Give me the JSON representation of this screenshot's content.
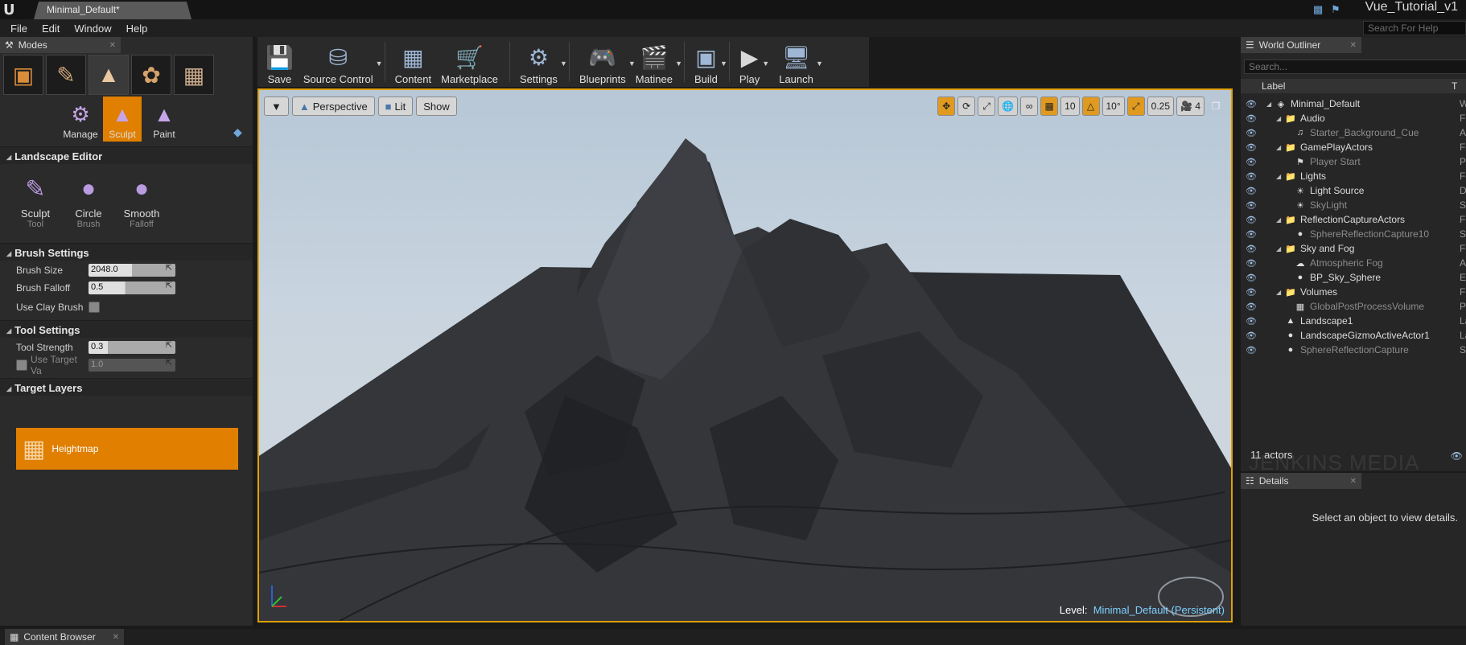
{
  "titlebar": {
    "doc_tab": "Minimal_Default*",
    "project": "Vue_Tutorial_v1"
  },
  "menu": {
    "items": [
      "File",
      "Edit",
      "Window",
      "Help"
    ],
    "help_search_placeholder": "Search For Help"
  },
  "modes": {
    "tab": "Modes",
    "landscape_tools": [
      {
        "label": "Manage",
        "active": false
      },
      {
        "label": "Sculpt",
        "active": true
      },
      {
        "label": "Paint",
        "active": false
      }
    ],
    "landscape_editor": {
      "header": "Landscape Editor",
      "tools": [
        {
          "label": "Sculpt",
          "sub": "Tool"
        },
        {
          "label": "Circle",
          "sub": "Brush"
        },
        {
          "label": "Smooth",
          "sub": "Falloff"
        }
      ]
    },
    "brush_settings": {
      "header": "Brush Settings",
      "brush_size_label": "Brush Size",
      "brush_size_value": "2048.0",
      "brush_size_fill": 0.5,
      "brush_falloff_label": "Brush Falloff",
      "brush_falloff_value": "0.5",
      "brush_falloff_fill": 0.42,
      "use_clay_label": "Use Clay Brush",
      "use_clay_checked": false
    },
    "tool_settings": {
      "header": "Tool Settings",
      "tool_strength_label": "Tool Strength",
      "tool_strength_value": "0.3",
      "tool_strength_fill": 0.22,
      "use_target_label": "Use Target Va",
      "use_target_value": "1.0"
    },
    "target_layers": {
      "header": "Target Layers",
      "heightmap_label": "Heightmap"
    }
  },
  "toolbar": {
    "buttons": [
      "Save",
      "Source Control",
      "Content",
      "Marketplace",
      "Settings",
      "Blueprints",
      "Matinee",
      "Build",
      "Play",
      "Launch"
    ]
  },
  "viewport": {
    "perspective": "Perspective",
    "lit": "Lit",
    "show": "Show",
    "grid_snap": "10",
    "rot_snap": "10°",
    "scale_snap": "0.25",
    "camera_speed": "4",
    "level_label": "Level:",
    "level_value": "Minimal_Default (Persistent)"
  },
  "outliner": {
    "tab": "World Outliner",
    "search_placeholder": "Search...",
    "col_label": "Label",
    "col_type": "T",
    "rows": [
      {
        "label": "Minimal_Default",
        "depth": 0,
        "icon": "W",
        "type": "W",
        "folder": false,
        "dim": false,
        "expander": true
      },
      {
        "label": "Audio",
        "depth": 1,
        "icon": "folder",
        "type": "Fo",
        "folder": true,
        "dim": false,
        "expander": true
      },
      {
        "label": "Starter_Background_Cue",
        "depth": 2,
        "icon": "audio",
        "type": "Ai",
        "folder": false,
        "dim": true,
        "expander": false
      },
      {
        "label": "GamePlayActors",
        "depth": 1,
        "icon": "folder",
        "type": "Fo",
        "folder": true,
        "dim": false,
        "expander": true
      },
      {
        "label": "Player Start",
        "depth": 2,
        "icon": "player",
        "type": "Pl",
        "folder": false,
        "dim": true,
        "expander": false
      },
      {
        "label": "Lights",
        "depth": 1,
        "icon": "folder",
        "type": "Fo",
        "folder": true,
        "dim": false,
        "expander": true
      },
      {
        "label": "Light Source",
        "depth": 2,
        "icon": "light",
        "type": "Di",
        "folder": false,
        "dim": false,
        "expander": false
      },
      {
        "label": "SkyLight",
        "depth": 2,
        "icon": "light",
        "type": "Sk",
        "folder": false,
        "dim": true,
        "expander": false
      },
      {
        "label": "ReflectionCaptureActors",
        "depth": 1,
        "icon": "folder",
        "type": "Fo",
        "folder": true,
        "dim": false,
        "expander": true
      },
      {
        "label": "SphereReflectionCapture10",
        "depth": 2,
        "icon": "sphere",
        "type": "Sp",
        "folder": false,
        "dim": true,
        "expander": false
      },
      {
        "label": "Sky and Fog",
        "depth": 1,
        "icon": "folder",
        "type": "Fo",
        "folder": true,
        "dim": false,
        "expander": true
      },
      {
        "label": "Atmospheric Fog",
        "depth": 2,
        "icon": "fog",
        "type": "At",
        "folder": false,
        "dim": true,
        "expander": false
      },
      {
        "label": "BP_Sky_Sphere",
        "depth": 2,
        "icon": "sphere",
        "type": "E",
        "folder": false,
        "dim": false,
        "expander": false
      },
      {
        "label": "Volumes",
        "depth": 1,
        "icon": "folder",
        "type": "Fo",
        "folder": true,
        "dim": false,
        "expander": true
      },
      {
        "label": "GlobalPostProcessVolume",
        "depth": 2,
        "icon": "volume",
        "type": "Po",
        "folder": false,
        "dim": true,
        "expander": false
      },
      {
        "label": "Landscape1",
        "depth": 1,
        "icon": "landscape",
        "type": "La",
        "folder": false,
        "dim": false,
        "expander": false
      },
      {
        "label": "LandscapeGizmoActiveActor1",
        "depth": 1,
        "icon": "sphere",
        "type": "La",
        "folder": false,
        "dim": false,
        "expander": false
      },
      {
        "label": "SphereReflectionCapture",
        "depth": 1,
        "icon": "sphere",
        "type": "Sp",
        "folder": false,
        "dim": true,
        "expander": false
      }
    ],
    "actors_count": "11 actors"
  },
  "details": {
    "tab": "Details",
    "message": "Select an object to view details."
  },
  "bottom": {
    "content_browser_tab": "Content Browser"
  },
  "watermark": "JENKINS MEDIA"
}
